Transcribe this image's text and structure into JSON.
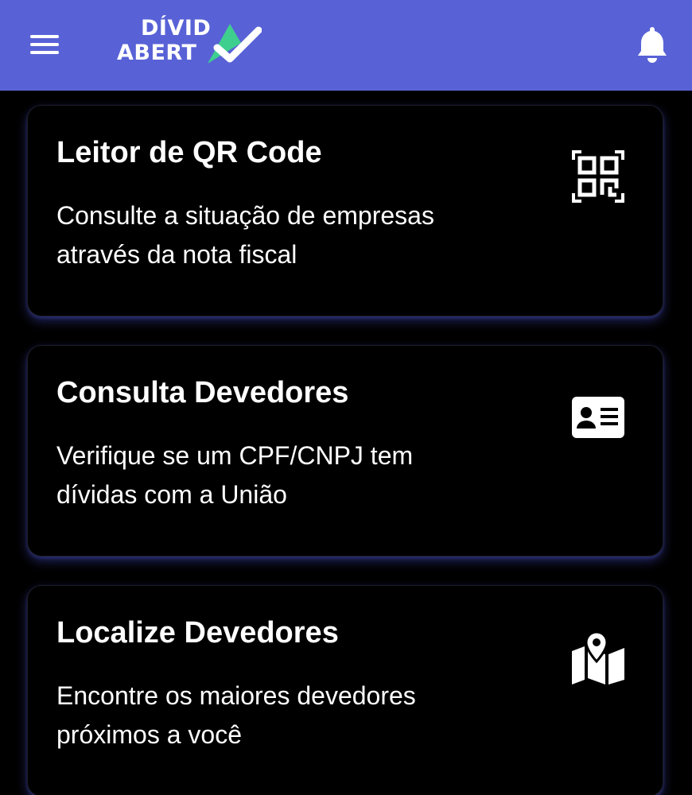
{
  "header": {
    "logo_line1": "DÍVID",
    "logo_line2": "ABERT",
    "menu_icon": "hamburger-menu-icon",
    "bell_icon": "bell-icon",
    "bg_color": "#5862d6",
    "accent_green": "#3ecf8e"
  },
  "cards": [
    {
      "title": "Leitor de QR Code",
      "description_line1": "Consulte a situação de empresas",
      "description_line2": "através da nota fiscal",
      "icon": "qr-code-icon"
    },
    {
      "title": "Consulta Devedores",
      "description_line1": "Verifique se um CPF/CNPJ tem",
      "description_line2": "dívidas com a União",
      "icon": "id-card-icon"
    },
    {
      "title": "Localize Devedores",
      "description_line1": "Encontre os maiores devedores",
      "description_line2": "próximos a você",
      "icon": "map-icon"
    }
  ]
}
